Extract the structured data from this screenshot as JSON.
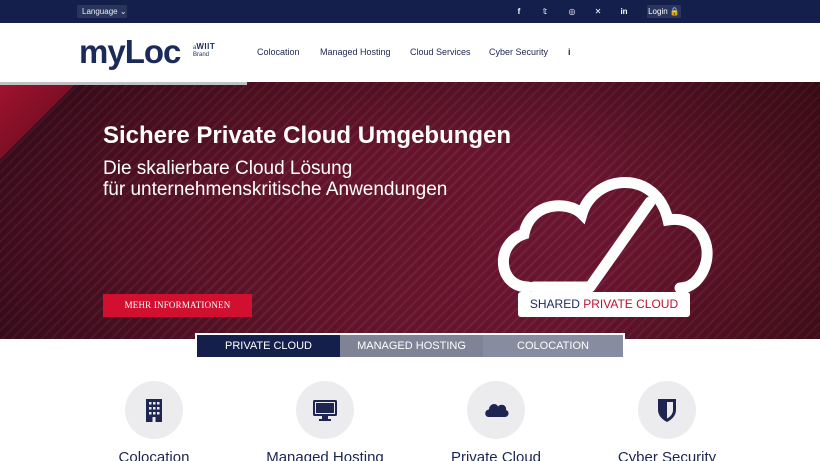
{
  "topbar": {
    "language_label": "Language ⌄",
    "social": [
      {
        "icon": "facebook-icon",
        "glyph": "f"
      },
      {
        "icon": "twitter-icon",
        "glyph": "𝕥"
      },
      {
        "icon": "instagram-icon",
        "glyph": "◎"
      },
      {
        "icon": "xing-icon",
        "glyph": "✕"
      },
      {
        "icon": "linkedin-icon",
        "glyph": "in"
      }
    ],
    "login_label": "Login 🔒"
  },
  "header": {
    "logo_text": "myLoc",
    "logo_sub_small": "a",
    "logo_sub_brand": "WIIT",
    "logo_sub_word": "Brand",
    "nav": [
      "Colocation",
      "Managed Hosting",
      "Cloud Services",
      "Cyber Security"
    ],
    "info_icon": "i"
  },
  "hero": {
    "title": "Sichere Private Cloud Umgebungen",
    "subtitle_line1": "Die skalierbare Cloud Lösung",
    "subtitle_line2": "für unternehmenskritische Anwendungen",
    "cta_label": "MEHR INFORMATIONEN",
    "badge_part1": "SHARED ",
    "badge_part2": "PRIVATE CLOUD"
  },
  "tabs": [
    "PRIVATE CLOUD",
    "MANAGED HOSTING",
    "COLOCATION"
  ],
  "services": [
    {
      "label": "Colocation",
      "icon": "building-icon"
    },
    {
      "label": "Managed Hosting",
      "icon": "monitor-icon"
    },
    {
      "label": "Private Cloud",
      "icon": "cloud-icon"
    },
    {
      "label": "Cyber Security",
      "icon": "shield-icon"
    }
  ],
  "colors": {
    "navy": "#141f4c",
    "brand_red": "#d1102f",
    "hero_burgundy": "#621329"
  }
}
